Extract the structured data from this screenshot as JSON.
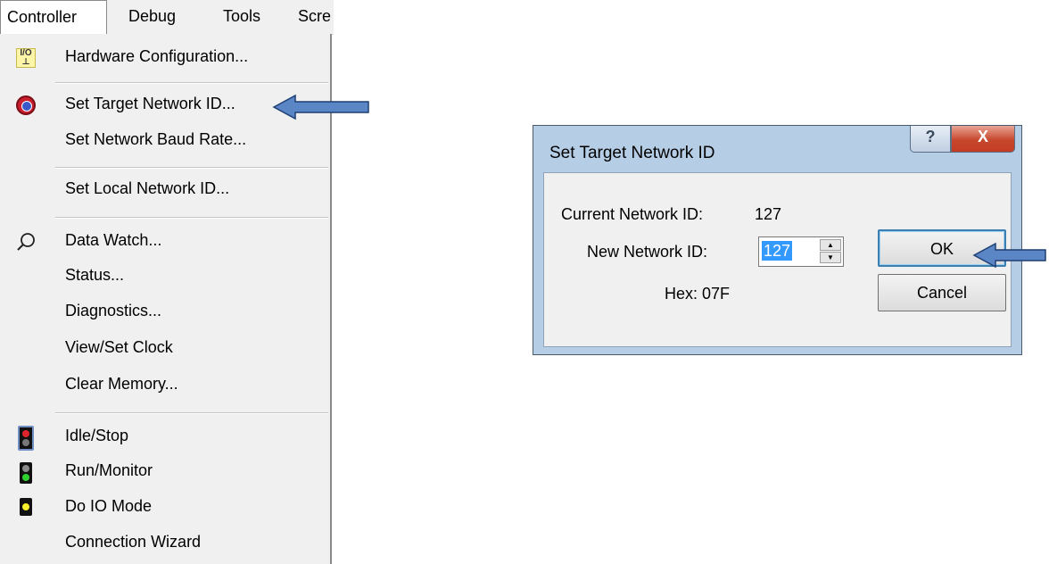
{
  "menubar": {
    "items": [
      "Controller",
      "Debug",
      "Tools",
      "Scre"
    ]
  },
  "menu": {
    "items": [
      {
        "label": "Hardware Configuration...",
        "icon": "io-config-icon"
      },
      {
        "label": "Set Target Network ID...",
        "icon": "target-network-icon"
      },
      {
        "label": "Set Network Baud Rate...",
        "icon": ""
      },
      {
        "label": "Set Local Network ID...",
        "icon": ""
      },
      {
        "label": "Data Watch...",
        "icon": "magnifier-icon"
      },
      {
        "label": "Status...",
        "icon": ""
      },
      {
        "label": "Diagnostics...",
        "icon": ""
      },
      {
        "label": "View/Set Clock",
        "icon": ""
      },
      {
        "label": "Clear Memory...",
        "icon": ""
      },
      {
        "label": "Idle/Stop",
        "icon": "red-light-icon"
      },
      {
        "label": "Run/Monitor",
        "icon": "green-light-icon"
      },
      {
        "label": "Do IO Mode",
        "icon": "yellow-light-icon"
      },
      {
        "label": "Connection Wizard",
        "icon": ""
      }
    ]
  },
  "dialog": {
    "title": "Set Target Network ID",
    "help_glyph": "?",
    "close_glyph": "X",
    "current_label": "Current Network ID:",
    "current_value": "127",
    "new_label": "New Network ID:",
    "new_value": "127",
    "hex_text": "Hex: 07F",
    "ok_label": "OK",
    "cancel_label": "Cancel"
  },
  "colors": {
    "arrow_fill": "#5a86c6",
    "arrow_stroke": "#1f3f73",
    "dialog_frame": "#b6cde6",
    "selection": "#3399ff"
  }
}
